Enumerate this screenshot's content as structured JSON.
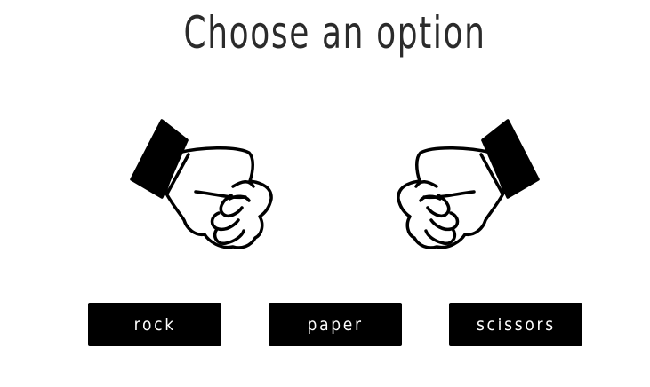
{
  "header": {
    "title": "Choose an option"
  },
  "hands": {
    "left_icon": "fist-icon",
    "right_icon": "fist-icon"
  },
  "options": {
    "rock_label": "rock",
    "paper_label": "paper",
    "scissors_label": "scissors"
  },
  "colors": {
    "background": "#ffffff",
    "button_bg": "#000000",
    "button_text": "#ffffff",
    "title_text": "#2b2b2b"
  }
}
